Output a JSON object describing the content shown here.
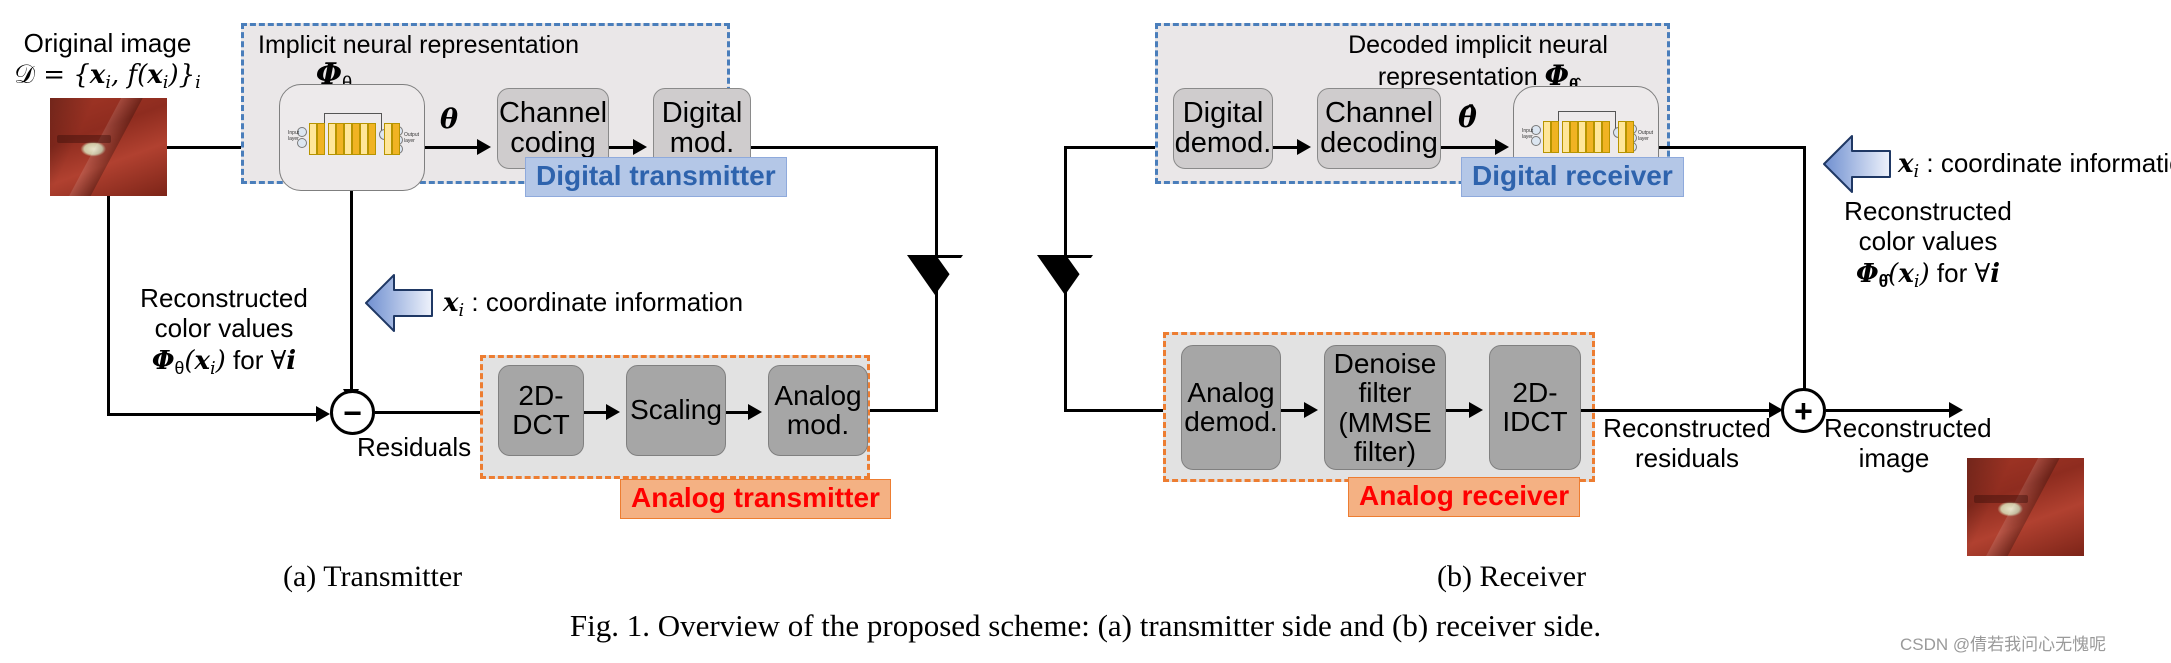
{
  "figure": {
    "caption": "Fig. 1.   Overview of the proposed scheme: (a) transmitter side and (b) receiver side.",
    "subcaption_a": "(a)  Transmitter",
    "subcaption_b": "(b)  Receiver",
    "watermark": "CSDN @倩若我问心无愧呢"
  },
  "colors": {
    "digital_dash": "#4a7ebb",
    "digital_tag_text": "#2e63ad",
    "digital_tag_bg": "#b4c7e7",
    "analog_dash": "#ed7d31",
    "analog_tag_text": "#ff0000",
    "analog_tag_bg": "#f4b183",
    "group_digital_bg": "#eae7e8",
    "group_analog_bg": "#e2e2e2",
    "block_light_bg": "#cfcccd",
    "block_dark_bg": "#a6a6a6",
    "arrow_blue": "#b4c8e8"
  },
  "transmitter": {
    "original_image_label_line1": "Original image",
    "original_image_label_line2_math": "𝒟 = {𝒙ᵢ, f(𝒙ᵢ)}ᵢ",
    "original_image_alt": "original-photo-red-door-latch",
    "digital_group": {
      "title": "Implicit neural representation",
      "title_symbol": "𝜱θ",
      "tag": "Digital transmitter",
      "inr_block_name": "implicit-neural-network",
      "blocks": [
        {
          "id": "channel-coding",
          "lines": [
            "Channel",
            "coding"
          ]
        },
        {
          "id": "digital-mod",
          "lines": [
            "Digital",
            "mod."
          ]
        }
      ],
      "theta_label": "θ"
    },
    "analog_group": {
      "tag": "Analog transmitter",
      "blocks": [
        {
          "id": "2d-dct",
          "lines": [
            "2D-",
            "DCT"
          ]
        },
        {
          "id": "scaling",
          "lines": [
            "Scaling"
          ]
        },
        {
          "id": "analog-mod",
          "lines": [
            "Analog",
            "mod."
          ]
        }
      ]
    },
    "coordinate_arrow_label": "𝒙ᵢ : coordinate information",
    "reconstructed_color_values": {
      "line1": "Reconstructed",
      "line2": "color values",
      "line3": "𝜱θ(𝒙ᵢ) for ∀𝒊"
    },
    "subtract_symbol": "−",
    "residuals_label": "Residuals",
    "antenna_name": "transmit-antenna"
  },
  "receiver": {
    "digital_group": {
      "title_line1": "Decoded implicit neural",
      "title_line2": "representation 𝜱θ̂",
      "tag": "Digital receiver",
      "inr_block_name": "decoded-implicit-neural-network",
      "blocks": [
        {
          "id": "digital-demod",
          "lines": [
            "Digital",
            "demod."
          ]
        },
        {
          "id": "channel-decoding",
          "lines": [
            "Channel",
            "decoding"
          ]
        }
      ],
      "theta_hat_label": "θ̂"
    },
    "analog_group": {
      "tag": "Analog receiver",
      "blocks": [
        {
          "id": "analog-demod",
          "lines": [
            "Analog",
            "demod."
          ]
        },
        {
          "id": "denoise-filter",
          "lines": [
            "Denoise",
            "filter",
            "(MMSE",
            "filter)"
          ]
        },
        {
          "id": "2d-idct",
          "lines": [
            "2D-",
            "IDCT"
          ]
        }
      ]
    },
    "coordinate_arrow_label": "𝒙ᵢ : coordinate information",
    "reconstructed_color_values": {
      "line1": "Reconstructed",
      "line2": "color values",
      "line3": "𝜱θ̂(𝒙ᵢ) for ∀𝒊"
    },
    "reconstructed_residuals": {
      "line1": "Reconstructed",
      "line2": "residuals"
    },
    "reconstructed_image": {
      "line1": "Reconstructed",
      "line2": "image"
    },
    "add_symbol": "+",
    "output_image_alt": "reconstructed-photo-red-door-latch",
    "antenna_name": "receive-antenna"
  }
}
